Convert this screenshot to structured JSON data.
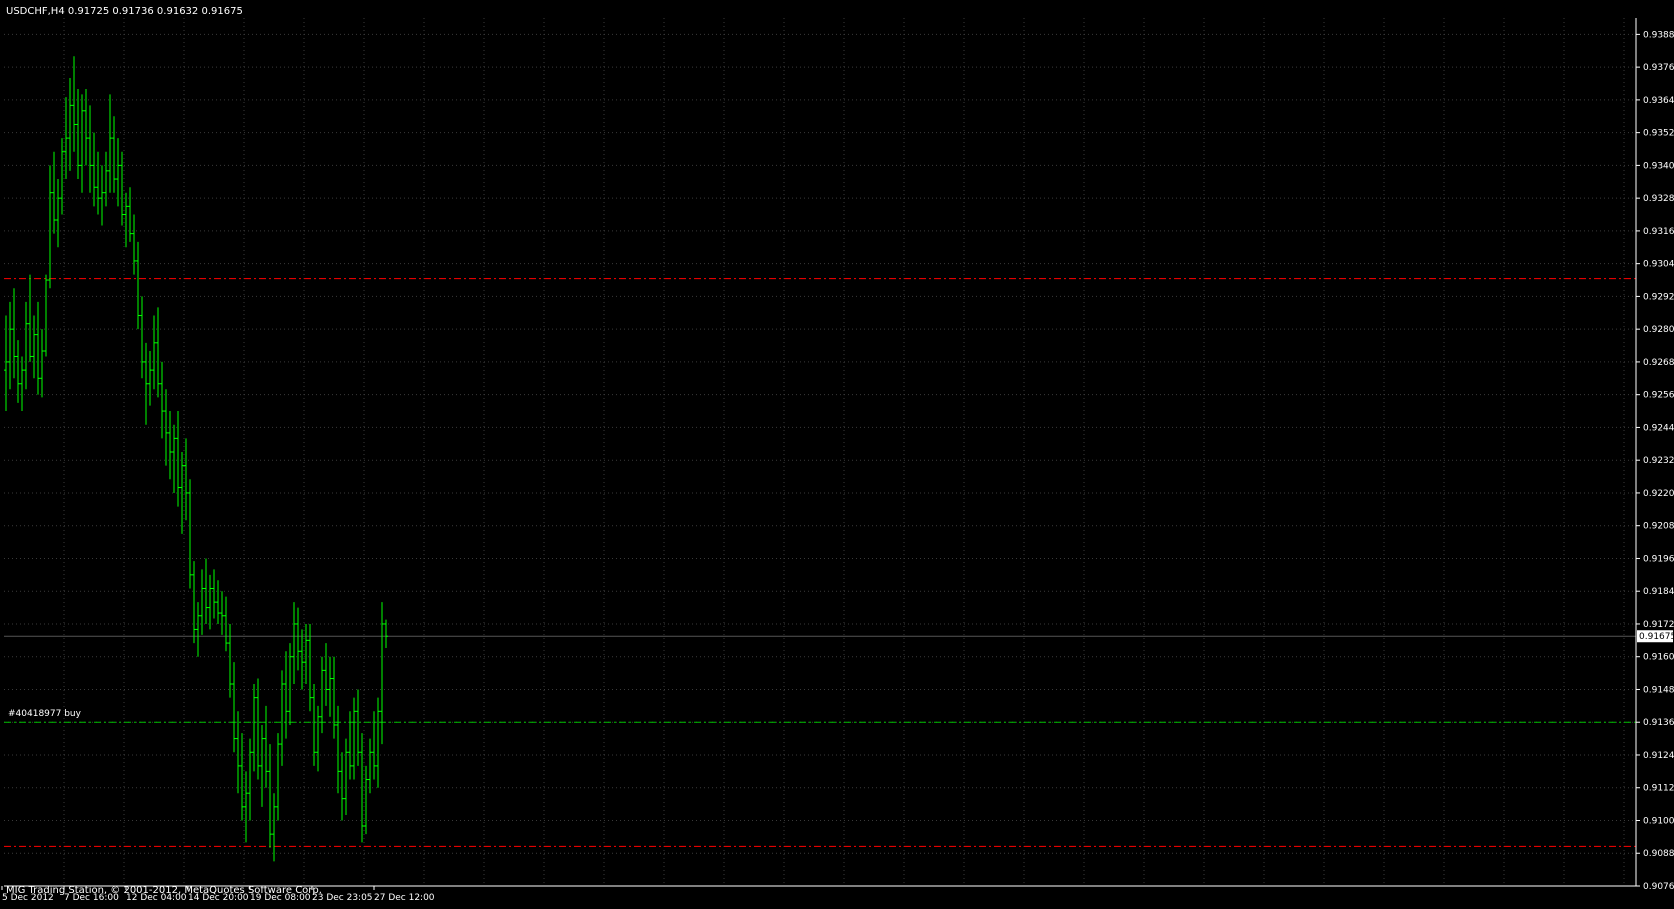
{
  "window": {
    "header": "USDCHF,H4  0.91725 0.91736 0.91632 0.91675",
    "watermark": "MIG Trading Station, © 2001-2012, MetaQuotes Software Corp."
  },
  "colors": {
    "background": "#000000",
    "candle": "#00ff00",
    "grid": "#3a3a3a",
    "axis": "#ffffff",
    "sl_tp_line": "#ff0000",
    "order_line": "#00c000"
  },
  "orders": [
    {
      "label": "#40418977 buy",
      "price": 0.9136,
      "type": "entry"
    },
    {
      "label": "",
      "price": 0.92985,
      "type": "take-profit"
    },
    {
      "label": "",
      "price": 0.90905,
      "type": "stop-loss"
    }
  ],
  "chart_data": {
    "type": "candlestick",
    "symbol": "USDCHF",
    "timeframe": "H4",
    "current_price": 0.91675,
    "ylim": [
      0.9076,
      0.9394
    ],
    "y_ticks": [
      "0.93880",
      "0.93760",
      "0.93640",
      "0.93520",
      "0.93400",
      "0.93280",
      "0.93160",
      "0.93040",
      "0.92920",
      "0.92800",
      "0.92680",
      "0.92560",
      "0.92440",
      "0.92320",
      "0.92200",
      "0.92080",
      "0.91960",
      "0.91840",
      "0.91720",
      "0.91600",
      "0.91480",
      "0.91360",
      "0.91240",
      "0.91120",
      "0.91000",
      "0.90880",
      "0.90760"
    ],
    "x_ticks": [
      "5 Dec 2012",
      "7 Dec 16:00",
      "12 Dec 04:00",
      "14 Dec 20:00",
      "19 Dec 08:00",
      "23 Dec 23:05",
      "27 Dec 12:00"
    ],
    "ohlc": [
      [
        0.9265,
        0.9285,
        0.925,
        0.9268
      ],
      [
        0.9268,
        0.929,
        0.9258,
        0.928
      ],
      [
        0.928,
        0.9295,
        0.9262,
        0.927
      ],
      [
        0.927,
        0.9276,
        0.9253,
        0.926
      ],
      [
        0.926,
        0.927,
        0.925,
        0.9265
      ],
      [
        0.9265,
        0.929,
        0.9258,
        0.9282
      ],
      [
        0.9282,
        0.93,
        0.9268,
        0.927
      ],
      [
        0.927,
        0.9285,
        0.9262,
        0.9278
      ],
      [
        0.9278,
        0.929,
        0.9256,
        0.9262
      ],
      [
        0.9262,
        0.928,
        0.9255,
        0.9272
      ],
      [
        0.9272,
        0.93,
        0.927,
        0.9298
      ],
      [
        0.9298,
        0.934,
        0.9295,
        0.933
      ],
      [
        0.933,
        0.9345,
        0.9315,
        0.932
      ],
      [
        0.932,
        0.9335,
        0.931,
        0.9328
      ],
      [
        0.9328,
        0.935,
        0.9322,
        0.9345
      ],
      [
        0.9345,
        0.9365,
        0.9335,
        0.935
      ],
      [
        0.935,
        0.9372,
        0.9338,
        0.9362
      ],
      [
        0.9362,
        0.938,
        0.9345,
        0.9355
      ],
      [
        0.9355,
        0.9368,
        0.9335,
        0.934
      ],
      [
        0.934,
        0.9366,
        0.933,
        0.936
      ],
      [
        0.936,
        0.9368,
        0.934,
        0.935
      ],
      [
        0.935,
        0.9362,
        0.933,
        0.934
      ],
      [
        0.934,
        0.9352,
        0.9325,
        0.9332
      ],
      [
        0.9332,
        0.9345,
        0.9322,
        0.9328
      ],
      [
        0.9328,
        0.934,
        0.9318,
        0.933
      ],
      [
        0.933,
        0.9345,
        0.9325,
        0.9338
      ],
      [
        0.9338,
        0.9366,
        0.933,
        0.935
      ],
      [
        0.935,
        0.9358,
        0.933,
        0.9335
      ],
      [
        0.9335,
        0.935,
        0.9325,
        0.934
      ],
      [
        0.934,
        0.9345,
        0.9318,
        0.9322
      ],
      [
        0.9322,
        0.933,
        0.931,
        0.9325
      ],
      [
        0.9325,
        0.9332,
        0.9312,
        0.9315
      ],
      [
        0.9315,
        0.9322,
        0.93,
        0.9305
      ],
      [
        0.9305,
        0.9312,
        0.928,
        0.9285
      ],
      [
        0.9285,
        0.9292,
        0.9262,
        0.9268
      ],
      [
        0.9268,
        0.9275,
        0.9245,
        0.926
      ],
      [
        0.926,
        0.9272,
        0.9252,
        0.9265
      ],
      [
        0.9265,
        0.9285,
        0.9258,
        0.9275
      ],
      [
        0.9275,
        0.9288,
        0.9255,
        0.926
      ],
      [
        0.926,
        0.9268,
        0.924,
        0.925
      ],
      [
        0.925,
        0.9258,
        0.923,
        0.9242
      ],
      [
        0.9242,
        0.925,
        0.9225,
        0.9235
      ],
      [
        0.9235,
        0.9245,
        0.922,
        0.924
      ],
      [
        0.924,
        0.925,
        0.9215,
        0.9222
      ],
      [
        0.9222,
        0.9235,
        0.9205,
        0.923
      ],
      [
        0.923,
        0.924,
        0.921,
        0.922
      ],
      [
        0.922,
        0.9225,
        0.9185,
        0.919
      ],
      [
        0.919,
        0.9195,
        0.9165,
        0.917
      ],
      [
        0.917,
        0.918,
        0.916,
        0.9175
      ],
      [
        0.9175,
        0.9192,
        0.9168,
        0.9185
      ],
      [
        0.9185,
        0.9196,
        0.9172,
        0.9178
      ],
      [
        0.9178,
        0.919,
        0.917,
        0.9185
      ],
      [
        0.9185,
        0.9192,
        0.9174,
        0.918
      ],
      [
        0.918,
        0.9188,
        0.9172,
        0.9176
      ],
      [
        0.9176,
        0.9184,
        0.9168,
        0.9175
      ],
      [
        0.9175,
        0.9182,
        0.9162,
        0.9165
      ],
      [
        0.9165,
        0.9172,
        0.9145,
        0.915
      ],
      [
        0.915,
        0.9158,
        0.9125,
        0.913
      ],
      [
        0.913,
        0.914,
        0.911,
        0.912
      ],
      [
        0.912,
        0.9132,
        0.91,
        0.9105
      ],
      [
        0.9105,
        0.9118,
        0.9092,
        0.911
      ],
      [
        0.911,
        0.913,
        0.91,
        0.9125
      ],
      [
        0.9125,
        0.915,
        0.9118,
        0.9145
      ],
      [
        0.9145,
        0.9152,
        0.9115,
        0.912
      ],
      [
        0.912,
        0.9135,
        0.9105,
        0.913
      ],
      [
        0.913,
        0.9142,
        0.9112,
        0.9118
      ],
      [
        0.9118,
        0.9128,
        0.909,
        0.9095
      ],
      [
        0.9095,
        0.911,
        0.9085,
        0.9105
      ],
      [
        0.9105,
        0.9132,
        0.91,
        0.9128
      ],
      [
        0.9128,
        0.9155,
        0.912,
        0.915
      ],
      [
        0.915,
        0.9162,
        0.913,
        0.914
      ],
      [
        0.914,
        0.9165,
        0.9135,
        0.916
      ],
      [
        0.916,
        0.918,
        0.915,
        0.9172
      ],
      [
        0.9172,
        0.9178,
        0.9155,
        0.9162
      ],
      [
        0.9162,
        0.917,
        0.9148,
        0.9158
      ],
      [
        0.9158,
        0.9172,
        0.915,
        0.9166
      ],
      [
        0.9166,
        0.9172,
        0.914,
        0.9145
      ],
      [
        0.9145,
        0.915,
        0.912,
        0.9125
      ],
      [
        0.9125,
        0.9142,
        0.9118,
        0.9138
      ],
      [
        0.9138,
        0.916,
        0.9132,
        0.9155
      ],
      [
        0.9155,
        0.9165,
        0.9142,
        0.9148
      ],
      [
        0.9148,
        0.916,
        0.9138,
        0.9152
      ],
      [
        0.9152,
        0.916,
        0.913,
        0.9135
      ],
      [
        0.9135,
        0.9142,
        0.911,
        0.9118
      ],
      [
        0.9118,
        0.9125,
        0.91,
        0.9108
      ],
      [
        0.9108,
        0.913,
        0.9102,
        0.9125
      ],
      [
        0.9125,
        0.914,
        0.9115,
        0.912
      ],
      [
        0.912,
        0.9145,
        0.9115,
        0.914
      ],
      [
        0.914,
        0.9148,
        0.912,
        0.9125
      ],
      [
        0.9125,
        0.9132,
        0.9092,
        0.9098
      ],
      [
        0.9098,
        0.912,
        0.9095,
        0.9115
      ],
      [
        0.9115,
        0.913,
        0.911,
        0.9125
      ],
      [
        0.9125,
        0.914,
        0.9115,
        0.912
      ],
      [
        0.912,
        0.9145,
        0.9112,
        0.914
      ],
      [
        0.914,
        0.918,
        0.9128,
        0.9172
      ],
      [
        0.9172,
        0.91736,
        0.91632,
        0.91675
      ]
    ]
  }
}
